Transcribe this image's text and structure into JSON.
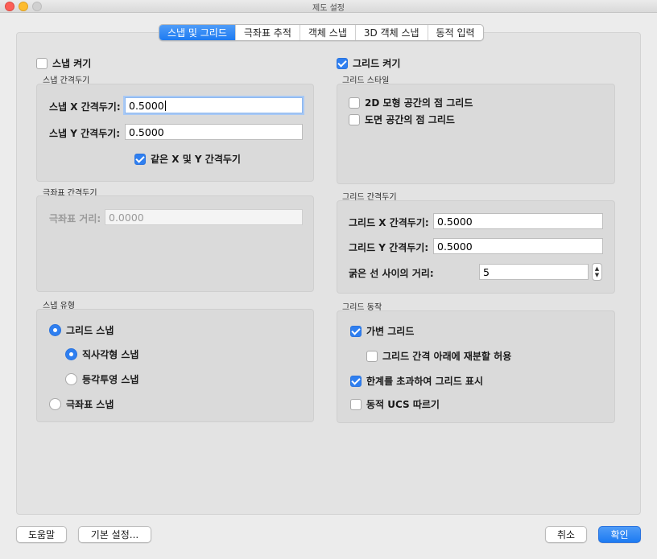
{
  "window": {
    "title": "제도 설정"
  },
  "tabs": [
    {
      "label": "스냅 및 그리드",
      "active": true
    },
    {
      "label": "극좌표 추적",
      "active": false
    },
    {
      "label": "객체 스냅",
      "active": false
    },
    {
      "label": "3D 객체 스냅",
      "active": false
    },
    {
      "label": "동적 입력",
      "active": false
    }
  ],
  "snap": {
    "snap_on_label": "스냅 켜기",
    "snap_on_checked": false,
    "spacing_group": "스냅 간격두기",
    "x_label": "스냅 X 간격두기:",
    "x_value": "0.5000",
    "y_label": "스냅 Y 간격두기:",
    "y_value": "0.5000",
    "equal_xy_label": "같은 X 및 Y 간격두기",
    "equal_xy_checked": true
  },
  "polar": {
    "group": "극좌표 간격두기",
    "distance_label": "극좌표 거리:",
    "distance_value": "0.0000"
  },
  "snap_type": {
    "group": "스냅 유형",
    "grid_snap": "그리드 스냅",
    "rectangular_snap": "직사각형 스냅",
    "isometric_snap": "등각투영 스냅",
    "polar_snap": "극좌표 스냅",
    "selected": "rectangular_snap"
  },
  "grid": {
    "grid_on_label": "그리드 켜기",
    "grid_on_checked": true,
    "style_group": "그리드 스타일",
    "dot_model_label": "2D 모형 공간의 점 그리드",
    "dot_model_checked": false,
    "dot_paper_label": "도면 공간의 점 그리드",
    "dot_paper_checked": false,
    "spacing_group": "그리드 간격두기",
    "x_label": "그리드 X 간격두기:",
    "x_value": "0.5000",
    "y_label": "그리드 Y 간격두기:",
    "y_value": "0.5000",
    "major_label": "굵은 선 사이의 거리:",
    "major_value": "5",
    "behavior_group": "그리드 동작",
    "adaptive_label": "가변 그리드",
    "adaptive_checked": true,
    "subdivide_label": "그리드 간격 아래에 재분할 허용",
    "subdivide_checked": false,
    "beyond_limits_label": "한계를 초과하여 그리드 표시",
    "beyond_limits_checked": true,
    "follow_ucs_label": "동적 UCS 따르기",
    "follow_ucs_checked": false
  },
  "buttons": {
    "help": "도움말",
    "defaults": "기본 설정...",
    "cancel": "취소",
    "ok": "확인"
  },
  "colors": {
    "accent": "#1d7bf2",
    "close": "#fc5f57",
    "minimize": "#fdbc2e"
  }
}
